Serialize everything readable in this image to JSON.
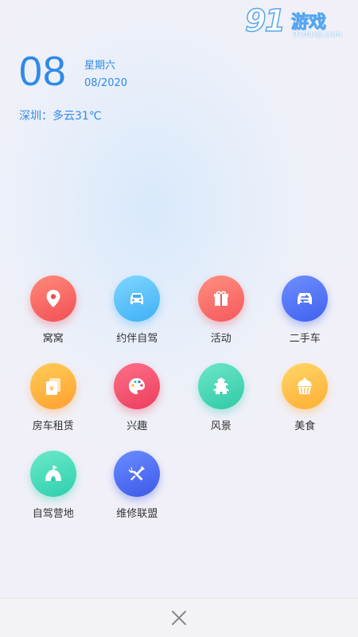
{
  "watermark": {
    "logo_number": "91",
    "logo_text": "游戏",
    "logo_url": "91danji.com"
  },
  "date": {
    "day": "08",
    "weekday": "星期六",
    "month_year": "08/2020"
  },
  "weather": {
    "text": "深圳：多云31℃"
  },
  "menu": {
    "items": [
      {
        "label": "窝窝",
        "icon": "location-pin-icon",
        "color": "#f24f55"
      },
      {
        "label": "约伴自驾",
        "icon": "car-icon",
        "color": "#3fb0f5"
      },
      {
        "label": "活动",
        "icon": "gift-icon",
        "color": "#f5595c"
      },
      {
        "label": "二手车",
        "icon": "exchange-car-icon",
        "color": "#3f62ee"
      },
      {
        "label": "房车租赁",
        "icon": "rental-bills-icon",
        "color": "#ffa030"
      },
      {
        "label": "兴趣",
        "icon": "palette-icon",
        "color": "#eb3e5e"
      },
      {
        "label": "风景",
        "icon": "pagoda-icon",
        "color": "#2fcaa8"
      },
      {
        "label": "美食",
        "icon": "cupcake-icon",
        "color": "#ffae33"
      },
      {
        "label": "自驾营地",
        "icon": "tent-icon",
        "color": "#2ecfae"
      },
      {
        "label": "维修联盟",
        "icon": "wrench-screwdriver-icon",
        "color": "#3c5ae8"
      }
    ]
  },
  "bottom_bar": {
    "close_icon": "close-icon"
  },
  "colors": {
    "accent": "#2f8ae8",
    "label_text": "#333333",
    "background": "#eef0f8"
  }
}
